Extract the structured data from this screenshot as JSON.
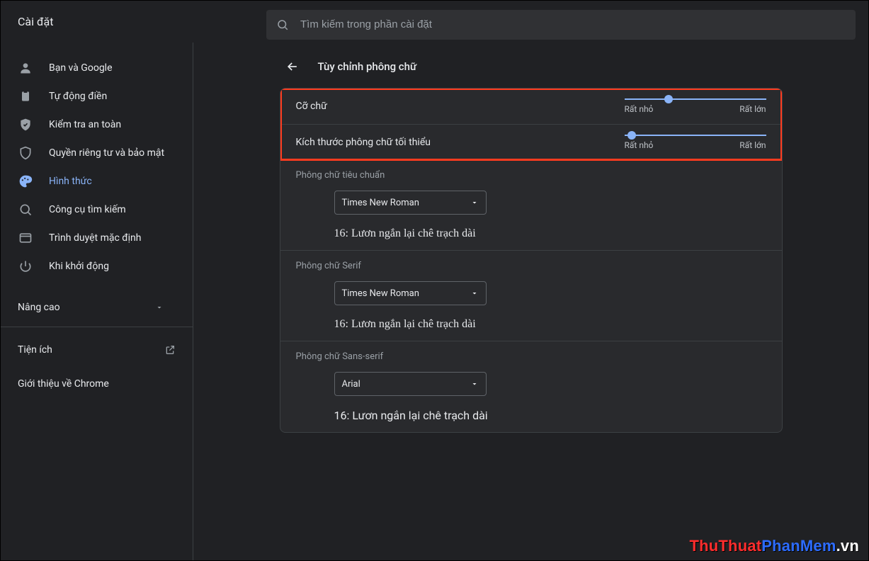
{
  "app": {
    "title": "Cài đặt"
  },
  "search": {
    "placeholder": "Tìm kiếm trong phần cài đặt"
  },
  "sidebar": {
    "items": [
      {
        "label": "Bạn và Google"
      },
      {
        "label": "Tự động điền"
      },
      {
        "label": "Kiểm tra an toàn"
      },
      {
        "label": "Quyền riêng tư và bảo mật"
      },
      {
        "label": "Hình thức"
      },
      {
        "label": "Công cụ tìm kiếm"
      },
      {
        "label": "Trình duyệt mặc định"
      },
      {
        "label": "Khi khởi động"
      }
    ],
    "advanced": "Nâng cao",
    "extensions": "Tiện ích",
    "about": "Giới thiệu về Chrome"
  },
  "page": {
    "title": "Tùy chỉnh phông chữ",
    "sliders": [
      {
        "label": "Cỡ chữ",
        "min_label": "Rất nhỏ",
        "max_label": "Rất lớn",
        "position_pct": 28
      },
      {
        "label": "Kích thước phông chữ tối thiểu",
        "min_label": "Rất nhỏ",
        "max_label": "Rất lớn",
        "position_pct": 2
      }
    ],
    "font_sections": [
      {
        "title": "Phông chữ tiêu chuẩn",
        "value": "Times New Roman",
        "sample": "16: Lươn ngắn lại chê trạch dài",
        "serif": true
      },
      {
        "title": "Phông chữ Serif",
        "value": "Times New Roman",
        "sample": "16: Lươn ngắn lại chê trạch dài",
        "serif": true
      },
      {
        "title": "Phông chữ Sans-serif",
        "value": "Arial",
        "sample": "16: Lươn ngắn lại chê trạch dài",
        "serif": false
      }
    ]
  },
  "watermark": {
    "a": "ThuThuat",
    "b": "PhanMem",
    "c": ".vn"
  }
}
